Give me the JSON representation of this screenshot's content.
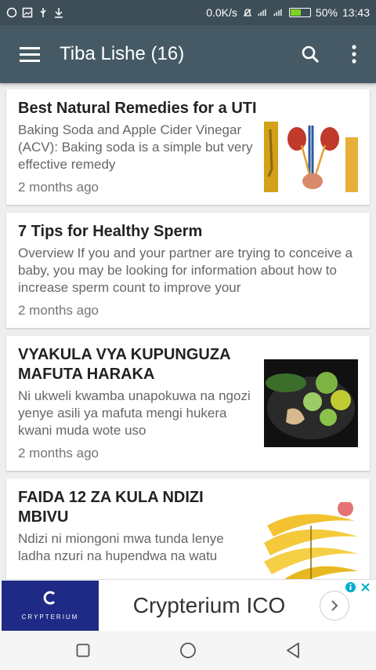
{
  "status_bar": {
    "network_speed": "0.0K/s",
    "battery_percent": "50%",
    "time": "13:43",
    "battery_level": 0.5
  },
  "app_bar": {
    "title": "Tiba Lishe (16)",
    "icons": [
      "menu-icon",
      "search-icon",
      "more-vert-icon"
    ]
  },
  "articles": [
    {
      "title": "Best Natural Remedies for a UTI",
      "excerpt": "Baking Soda and Apple Cider Vinegar (ACV): Baking soda is a simple but very effective remedy",
      "time": "2 months ago",
      "thumbnail": "urinary-system-image"
    },
    {
      "title": "7 Tips for Healthy Sperm",
      "excerpt": "Overview If you and your partner are trying to conceive a baby, you may be looking for information about  how to increase sperm count  to improve your",
      "time": "2 months ago",
      "thumbnail": null
    },
    {
      "title": "VYAKULA VYA KUPUNGUZA MAFUTA HARAKA",
      "excerpt": "Ni ukweli kwamba unapokuwa na ngozi yenye asili ya mafuta mengi hukera kwani muda wote uso",
      "time": "2 months ago",
      "thumbnail": "vegetables-bowl-image"
    },
    {
      "title": "FAIDA 12 ZA KULA NDIZI MBIVU",
      "excerpt": "Ndizi ni miongoni mwa tunda lenye ladha nzuri na hupendwa na watu",
      "time": "",
      "thumbnail": "bananas-image"
    }
  ],
  "ad": {
    "logo_text": "CRYPTERIUM",
    "headline": "Crypterium ICO",
    "brand_color": "#1f2a86"
  },
  "colors": {
    "app_bar": "#455a64",
    "status_bar": "#3d4e58",
    "background": "#eeeeee"
  }
}
